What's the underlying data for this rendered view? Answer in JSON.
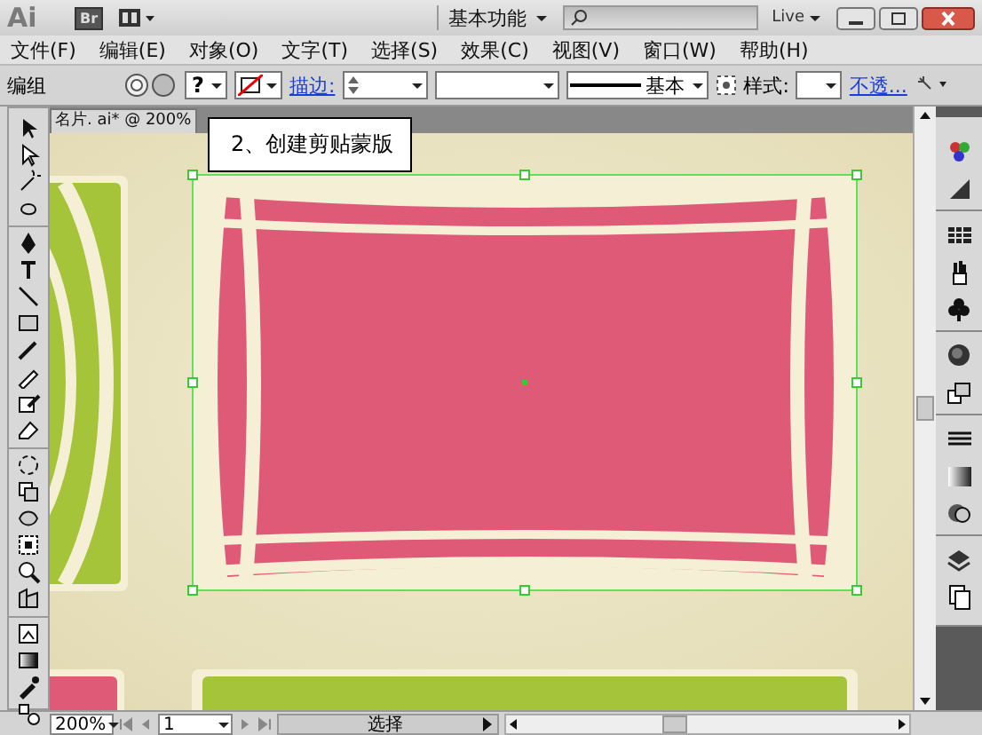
{
  "title_bar": {
    "app_logo": "Ai",
    "bridge_button": "Br",
    "workspace": "基本功能",
    "live": "Live"
  },
  "menu": [
    {
      "label": "文件(F)"
    },
    {
      "label": "编辑(E)"
    },
    {
      "label": "对象(O)"
    },
    {
      "label": "文字(T)"
    },
    {
      "label": "选择(S)"
    },
    {
      "label": "效果(C)"
    },
    {
      "label": "视图(V)"
    },
    {
      "label": "窗口(W)"
    },
    {
      "label": "帮助(H)"
    }
  ],
  "control_bar": {
    "selection": "编组",
    "fill_swatch": "?",
    "stroke_label": "描边:",
    "stroke_style": "基本",
    "style_label": "样式:",
    "opacity_link": "不透..."
  },
  "document_tab": "名片. ai* @ 200%",
  "callout": "2、创建剪贴蒙版",
  "status_bar": {
    "zoom": "200%",
    "page": "1",
    "status": "选择"
  }
}
